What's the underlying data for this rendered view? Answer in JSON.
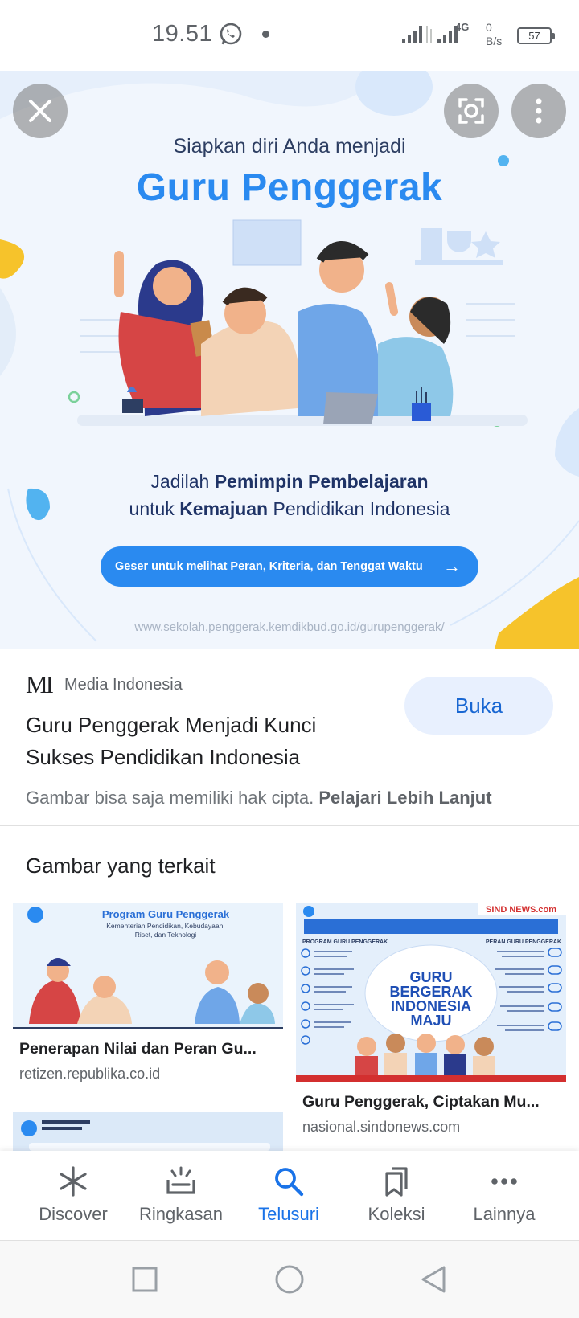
{
  "status_bar": {
    "time": "19.51",
    "network": "4G",
    "speed_value": "0",
    "speed_unit": "B/s",
    "battery": "57"
  },
  "hero": {
    "line1": "Siapkan diri Anda menjadi",
    "title": "Guru Penggerak",
    "tagline_1_a": "Jadilah ",
    "tagline_1_b": "Pemimpin Pembelajaran",
    "tagline_2_a": "untuk ",
    "tagline_2_b": "Kemajuan",
    "tagline_2_c": " Pendidikan Indonesia",
    "cta": "Geser untuk melihat Peran, Kriteria, dan Tenggat Waktu",
    "cta_arrow": "→",
    "url": "www.sekolah.penggerak.kemdikbud.go.id/gurupenggerak/"
  },
  "result": {
    "source_logo": "MI",
    "source_name": "Media Indonesia",
    "open_label": "Buka",
    "title_line1": "Guru Penggerak Menjadi Kunci",
    "title_line2": "Sukses Pendidikan Indonesia",
    "copyright_text": "Gambar bisa saja memiliki hak cipta.",
    "learn_more": "Pelajari Lebih Lanjut"
  },
  "related": {
    "title": "Gambar yang terkait",
    "cards": [
      {
        "caption": "Penerapan Nilai dan Peran Gu...",
        "domain": "retizen.republika.co.id",
        "thumb_title": "Program Guru Penggerak",
        "thumb_sub1": "Kementerian Pendidikan, Kebudayaan,",
        "thumb_sub2": "Riset, dan Teknologi"
      },
      {
        "caption": "Guru Penggerak, Ciptakan Mu...",
        "domain": "nasional.sindonews.com",
        "thumb_brand": "SIND NEWS.com",
        "thumb_line1": "GURU",
        "thumb_line2": "BERGERAK",
        "thumb_line3": "INDONESIA",
        "thumb_line4": "MAJU",
        "thumb_left_head": "PROGRAM GURU PENGGERAK",
        "thumb_right_head": "PERAN GURU PENGGERAK"
      }
    ]
  },
  "bottom_nav": [
    {
      "label": "Discover",
      "icon": "asterisk-icon"
    },
    {
      "label": "Ringkasan",
      "icon": "summary-icon"
    },
    {
      "label": "Telusuri",
      "icon": "search-icon",
      "active": true
    },
    {
      "label": "Koleksi",
      "icon": "bookmarks-icon"
    },
    {
      "label": "Lainnya",
      "icon": "more-horizontal-icon"
    }
  ],
  "colors": {
    "accent": "#1a73e8",
    "hero_blue": "#2a8af0",
    "open_bg": "#e8f0fe"
  }
}
